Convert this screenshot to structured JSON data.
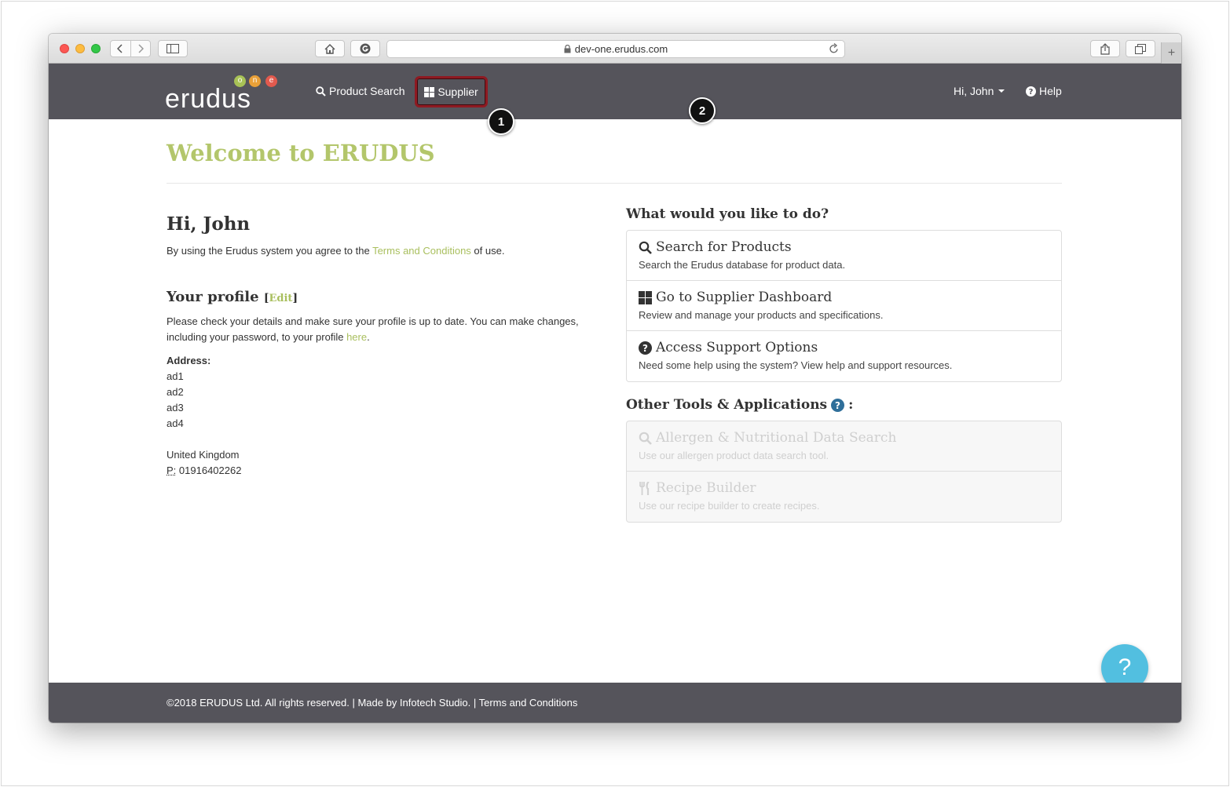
{
  "browser": {
    "url": "dev-one.erudus.com"
  },
  "navbar": {
    "logo_text": "erudus",
    "logo_letters": [
      "o",
      "n",
      "e"
    ],
    "product_search_label": "Product Search",
    "supplier_label": "Supplier",
    "user_label": "Hi, John",
    "help_label": "Help"
  },
  "callouts": {
    "one": "1",
    "two": "2"
  },
  "main": {
    "welcome_title": "Welcome to ERUDUS",
    "greeting": "Hi, John",
    "terms_prefix": "By using the Erudus system you agree to the ",
    "terms_link": "Terms and Conditions",
    "terms_suffix": " of use.",
    "profile_heading": "Your profile",
    "profile_edit": "Edit",
    "profile_text": "Please check your details and make sure your profile is up to date. You can make changes, including your password, to your profile ",
    "profile_here": "here",
    "profile_end": ".",
    "address_label": "Address:",
    "address_lines": [
      "ad1",
      "ad2",
      "ad3",
      "ad4"
    ],
    "country": "United Kingdom",
    "phone_label": "P:",
    "phone": "01916402262"
  },
  "actions": {
    "heading": "What would you like to do?",
    "items": [
      {
        "title": "Search for Products",
        "desc": "Search the Erudus database for product data.",
        "icon": "search-icon"
      },
      {
        "title": "Go to Supplier Dashboard",
        "desc": "Review and manage your products and specifications.",
        "icon": "dashboard-icon"
      },
      {
        "title": "Access Support Options",
        "desc": "Need some help using the system? View help and support resources.",
        "icon": "question-circle-icon"
      }
    ]
  },
  "tools": {
    "heading": "Other Tools & Applications",
    "suffix": ":",
    "items": [
      {
        "title": "Allergen & Nutritional Data Search",
        "desc": "Use our allergen product data search tool.",
        "icon": "search-icon"
      },
      {
        "title": "Recipe Builder",
        "desc": "Use our recipe builder to create recipes.",
        "icon": "cutlery-icon"
      }
    ]
  },
  "help_fab": "?",
  "footer": {
    "text": "©2018 ERUDUS Ltd. All rights reserved. | Made by Infotech Studio. | Terms and Conditions"
  },
  "colors": {
    "accent": "#b3c66b",
    "navbar": "#55545b",
    "highlight": "#8e1a22",
    "fab": "#52bfe0"
  }
}
